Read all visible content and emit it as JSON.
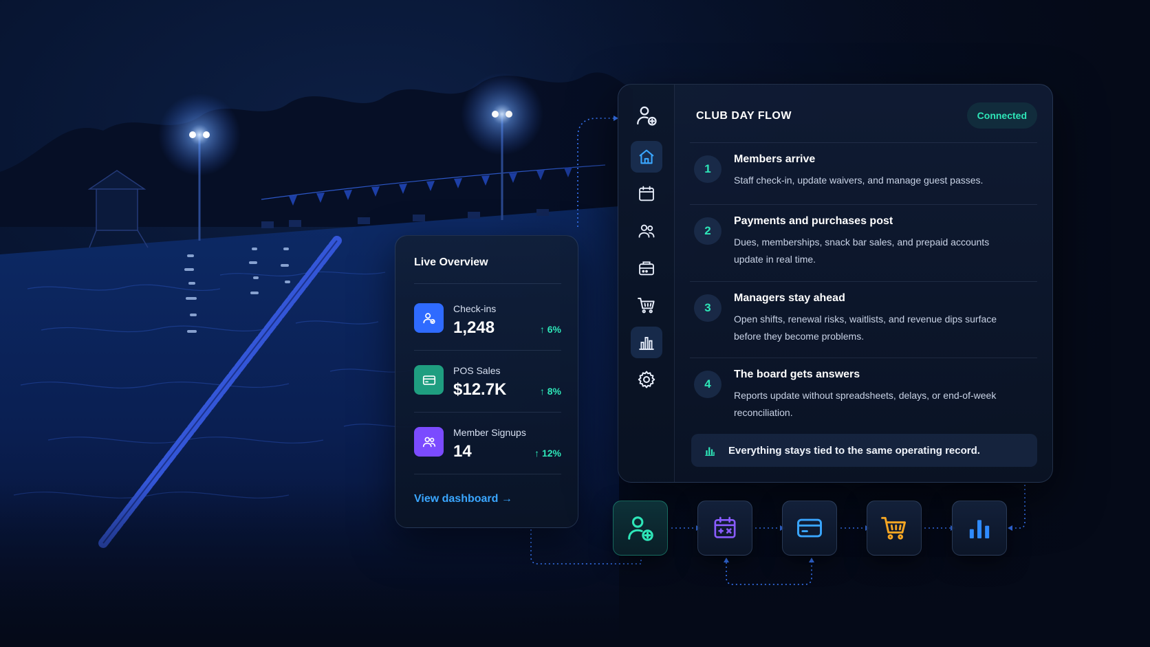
{
  "live_overview": {
    "title": "Live Overview",
    "metrics": [
      {
        "label": "Check-ins",
        "value": "1,248",
        "delta": "↑ 6%",
        "icon": "user-check-icon",
        "color": "#2f6bff"
      },
      {
        "label": "POS Sales",
        "value": "$12.7K",
        "delta": "↑ 8%",
        "icon": "card-icon",
        "color": "#1f9e80"
      },
      {
        "label": "Member Signups",
        "value": "14",
        "delta": "↑ 12%",
        "icon": "users-icon",
        "color": "#7b4bff"
      }
    ],
    "link_label": "View dashboard →"
  },
  "flow_panel": {
    "title": "CLUB DAY FLOW",
    "status": "Connected",
    "sidebar": [
      {
        "icon": "user-add-icon"
      },
      {
        "icon": "home-icon",
        "active": true
      },
      {
        "icon": "calendar-icon"
      },
      {
        "icon": "users-icon"
      },
      {
        "icon": "register-icon"
      },
      {
        "icon": "cart-icon"
      },
      {
        "icon": "bar-chart-icon"
      },
      {
        "icon": "gear-icon"
      }
    ],
    "steps": [
      {
        "num": "1",
        "title": "Members arrive",
        "desc": "Staff check-in, update waivers, and manage guest passes."
      },
      {
        "num": "2",
        "title": "Payments and purchases post",
        "desc": "Dues, memberships, snack bar sales, and prepaid accounts update in real time."
      },
      {
        "num": "3",
        "title": "Managers stay ahead",
        "desc": "Open shifts, renewal risks, waitlists, and revenue dips surface before they become problems."
      },
      {
        "num": "4",
        "title": "The board gets answers",
        "desc": "Reports update without spreadsheets, delays, or end-of-week reconciliation."
      }
    ],
    "footer": "Everything stays tied to the same operating record."
  },
  "flow_tiles": [
    {
      "icon": "user-add-icon",
      "color": "#2ee6b8"
    },
    {
      "icon": "calendar-icon",
      "color": "#8a5cff"
    },
    {
      "icon": "card-icon",
      "color": "#3aa6ff"
    },
    {
      "icon": "cart-icon",
      "color": "#f5a623"
    },
    {
      "icon": "bar-chart-icon",
      "color": "#2f8bff"
    }
  ],
  "colors": {
    "accent_teal": "#2ee6b8",
    "accent_blue": "#3aa6ff",
    "background": "#050a18"
  }
}
